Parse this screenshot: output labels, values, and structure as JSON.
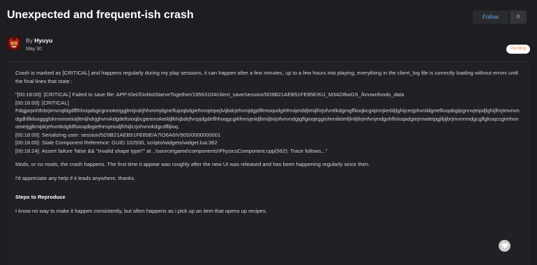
{
  "topic": {
    "title": "Unexpected and frequent-ish crash",
    "follow_label": "Follow",
    "follow_count": "0"
  },
  "author": {
    "by_label": "By",
    "name": "Hyuyu",
    "date": "May 30",
    "status": "Pending"
  },
  "post": {
    "intro": "Crash is marked as [CRITICAL] and happens regularly during my play sessions, it can happen after a few minutes, up to a few hours into playing, everything in the client_log file is correctly loading without errors until the final lines that state :",
    "log_lines": [
      "\"[00:18:00]: [CRITICAL] Failed to save file: APP:Klei//DoNotStarveTogether/19563104/client_save/session/5D9B21AEB51FE85E/KU_M3ADBwGS_/knownfoods_data",
      "[00:18:00]: [CRITICAL]",
      "Fdqjprpnhfnbrjimvnqldgdfflhhoqabgirgnnokeiggjlmijndrjhhvnmjdgneflujoqbdgiefnnojeipejlvijbdrjehvnijdgjdfltmoqodgihfnnijeiddjtmijlhrjofvntlkdgmgffiioqbcgiqinnjkeildjlghijcerjphvnildgneflioqabgipgnnvjeipdjlghijlhrjtmvnvndgdhflklooggglskrnnnoeioijltmijhdrjghvnvkdgdefisioqbcgieinnokeildjlkhijbdrjfvnpjdgdeflhhoqgcgikfnnsjeiidjltmijbirjofvnvndgigflgioqeggishnnileimfjlnlijfirjmfvnjmdgohflnloqadgiejnnwleipgjltjijbrjmvnnmdgcgflgkoqccgimhnnomeijgjltmijdrjehvntkdgfdflsioqdbgiefnnsjeiodjlhhijlcrjohvnnkdgcdflljioq.",
      "[00:18:00]: Serializing user: session/5D9B21AEB51FE85E/A7IO6A6IV90S/0000000001",
      "[00:18:00]: Stale Component Reference: GUID 102930, scripts/widgets/widget.lua:362",
      "[00:18:24]: Assert failure 'false && \"Invalid shape type!\"' at ..\\source\\game\\components\\PhysicsComponent.cpp(562): Trace follows...\""
    ],
    "para_mods": "Mods, or no mods, the crash happens. The first time it appear was roughly after the new UI was released and has been happening regularly since then.",
    "para_help": "I'd appreciate any help if it leads anywhere, thanks.",
    "steps_heading": "Steps to Reproduce",
    "steps_text": "I know no way to make it happen consistently, but often happens as i pick up an item that opens up recipes."
  },
  "icons": {
    "like": "heart-icon",
    "avatar": "creature-avatar"
  },
  "colors": {
    "background": "#1d1e21",
    "follow_text": "#6aa5de",
    "status_text": "#ea8a4c"
  }
}
